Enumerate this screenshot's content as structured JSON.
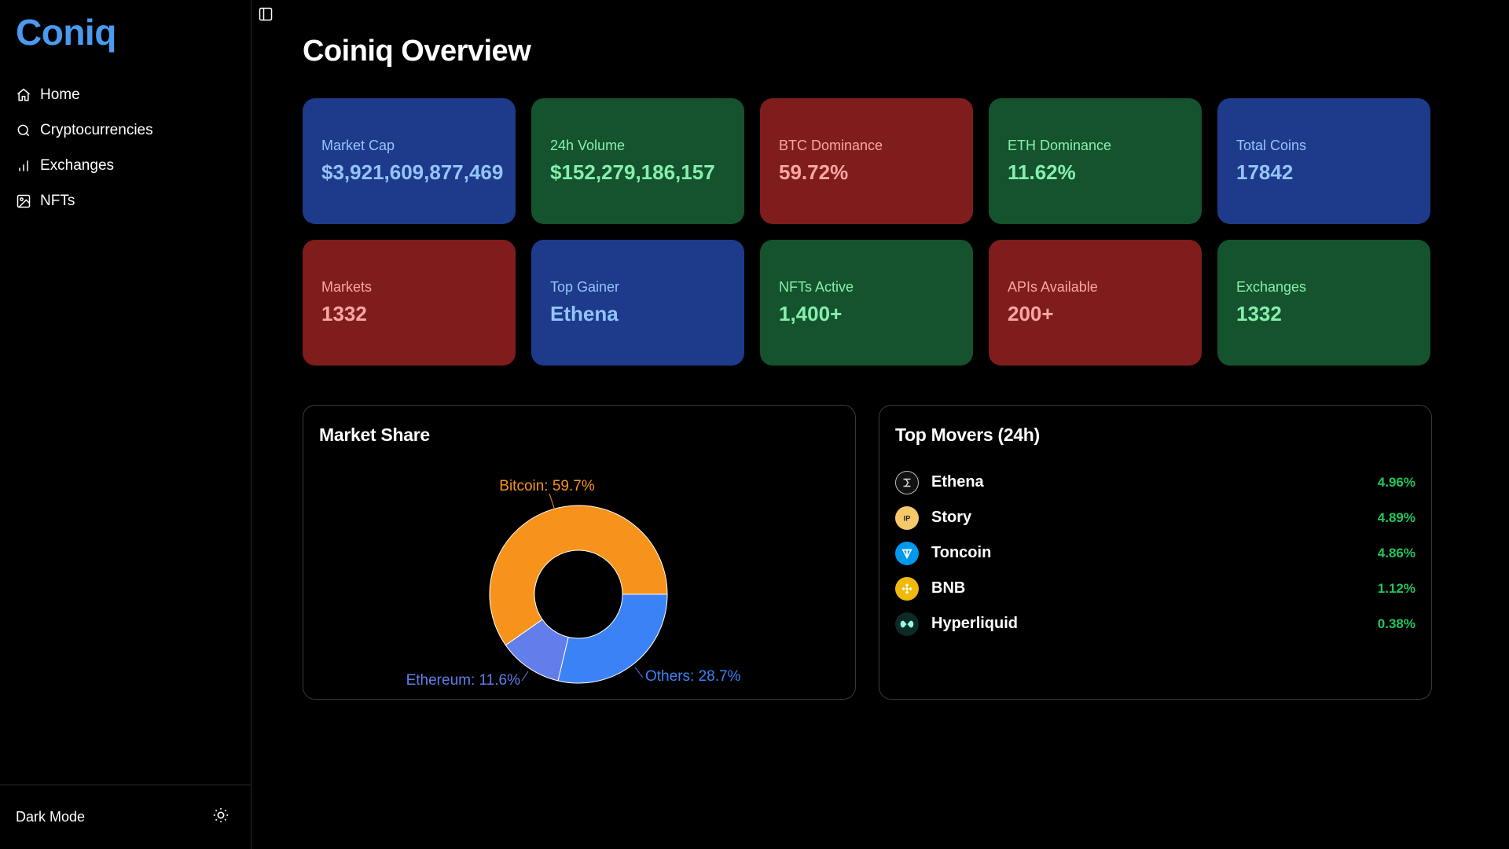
{
  "app": {
    "logo": "Coniq"
  },
  "sidebar": {
    "items": [
      {
        "label": "Home",
        "icon": "home-icon"
      },
      {
        "label": "Cryptocurrencies",
        "icon": "search-icon"
      },
      {
        "label": "Exchanges",
        "icon": "bar-chart-icon"
      },
      {
        "label": "NFTs",
        "icon": "image-icon"
      }
    ],
    "footer": {
      "label": "Dark Mode",
      "icon": "sun-icon"
    }
  },
  "main": {
    "title": "Coiniq Overview",
    "stats": [
      {
        "label": "Market Cap",
        "value": "$3,921,609,877,469",
        "color": "blue"
      },
      {
        "label": "24h Volume",
        "value": "$152,279,186,157",
        "color": "green"
      },
      {
        "label": "BTC Dominance",
        "value": "59.72%",
        "color": "red"
      },
      {
        "label": "ETH Dominance",
        "value": "11.62%",
        "color": "green"
      },
      {
        "label": "Total Coins",
        "value": "17842",
        "color": "blue"
      },
      {
        "label": "Markets",
        "value": "1332",
        "color": "red"
      },
      {
        "label": "Top Gainer",
        "value": "Ethena",
        "color": "blue"
      },
      {
        "label": "NFTs Active",
        "value": "1,400+",
        "color": "green"
      },
      {
        "label": "APIs Available",
        "value": "200+",
        "color": "red"
      },
      {
        "label": "Exchanges",
        "value": "1332",
        "color": "green"
      }
    ],
    "market_share": {
      "title": "Market Share"
    },
    "top_movers": {
      "title": "Top Movers (24h)",
      "items": [
        {
          "name": "Ethena",
          "change": "4.96%",
          "icon": "ethena-icon"
        },
        {
          "name": "Story",
          "change": "4.89%",
          "icon": "story-icon"
        },
        {
          "name": "Toncoin",
          "change": "4.86%",
          "icon": "toncoin-icon"
        },
        {
          "name": "BNB",
          "change": "1.12%",
          "icon": "bnb-icon"
        },
        {
          "name": "Hyperliquid",
          "change": "0.38%",
          "icon": "hyperliquid-icon"
        }
      ]
    }
  },
  "chart_data": {
    "type": "pie",
    "title": "Market Share",
    "categories": [
      "Bitcoin",
      "Ethereum",
      "Others"
    ],
    "values": [
      59.7,
      11.6,
      28.7
    ],
    "labels": [
      "Bitcoin: 59.7%",
      "Ethereum: 11.6%",
      "Others: 28.7%"
    ],
    "colors": [
      "#f7931a",
      "#627eea",
      "#3b82f6"
    ],
    "donut": true
  },
  "colors": {
    "accent": "#4a9af0",
    "positive": "#22c55e",
    "card_blue": "#1e3a8a",
    "card_green": "#14532d",
    "card_red": "#7f1d1d"
  }
}
